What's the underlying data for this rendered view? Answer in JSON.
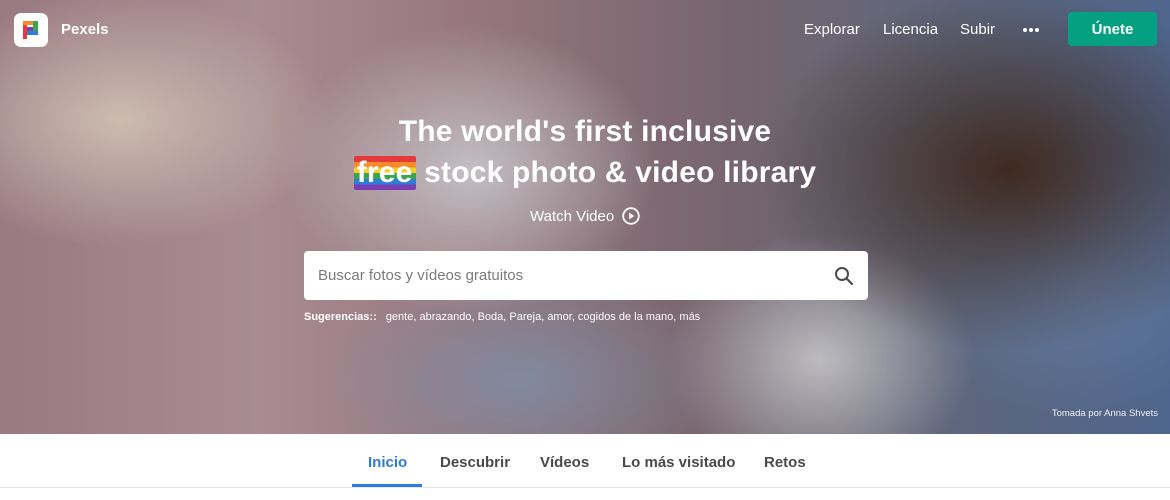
{
  "brand": {
    "name": "Pexels"
  },
  "nav": {
    "links": [
      "Explorar",
      "Licencia",
      "Subir"
    ],
    "join_label": "Únete",
    "join_color": "#05a081"
  },
  "hero": {
    "headline_line1": "The world's first inclusive",
    "headline_free": "free",
    "headline_line2_rest": " stock photo & video library",
    "watch_video_label": "Watch Video",
    "credit": "Tomada por Anna Shvets"
  },
  "search": {
    "placeholder": "Buscar fotos y vídeos gratuitos"
  },
  "suggestions": {
    "label": "Sugerencias::",
    "items": [
      "gente,",
      "abrazando,",
      "Boda,",
      "Pareja,",
      "amor,",
      "cogidos de la mano,",
      "más"
    ]
  },
  "tabs": {
    "items": [
      "Inicio",
      "Descubrir",
      "Vídeos",
      "Lo más visitado",
      "Retos"
    ],
    "active_index": 0,
    "accent_color": "#2c7bd6"
  },
  "icons": {
    "logo": "pexels-logo-icon",
    "more": "more-dots-icon",
    "play": "play-circle-icon",
    "search": "search-icon"
  }
}
